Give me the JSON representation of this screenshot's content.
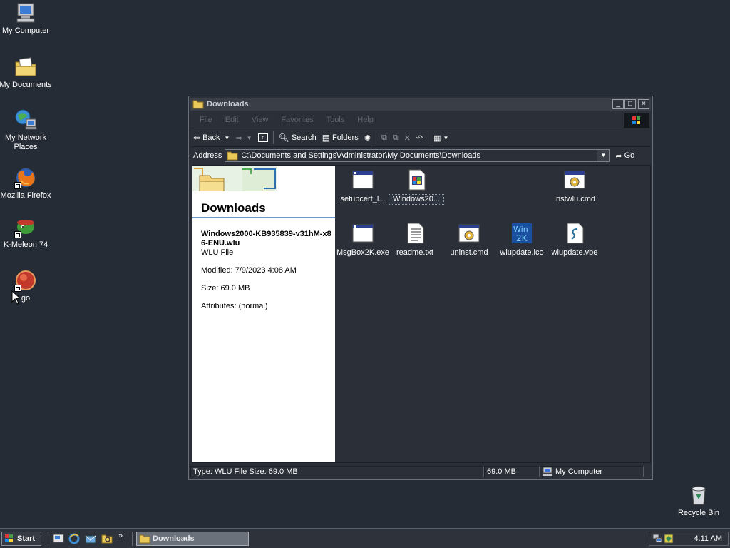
{
  "desktop": {
    "icons": [
      {
        "label": "My Computer",
        "icon": "computer-icon"
      },
      {
        "label": "My Documents",
        "icon": "documents-folder-icon"
      },
      {
        "label": "My Network Places",
        "icon": "network-icon"
      },
      {
        "label": "Mozilla Firefox",
        "icon": "firefox-icon"
      },
      {
        "label": "K-Meleon 74",
        "icon": "k-meleon-icon"
      },
      {
        "label": "go",
        "icon": "go-icon"
      }
    ],
    "recycle_bin": {
      "label": "Recycle Bin",
      "icon": "recycle-bin-icon"
    }
  },
  "window": {
    "title": "Downloads",
    "menu": [
      "File",
      "Edit",
      "View",
      "Favorites",
      "Tools",
      "Help"
    ],
    "toolbar": {
      "back": "Back",
      "search": "Search",
      "folders": "Folders"
    },
    "address": {
      "label": "Address",
      "value": "C:\\Documents and Settings\\Administrator\\My Documents\\Downloads",
      "go": "Go"
    },
    "left_pane": {
      "title": "Downloads",
      "file_name": "Windows2000-KB935839-v31hM-x86-ENU.wlu",
      "file_type": "WLU File",
      "modified": "Modified: 7/9/2023 4:08 AM",
      "size": "Size: 69.0 MB",
      "attributes": "Attributes: (normal)"
    },
    "files": [
      {
        "name": "setupcert_l...",
        "icon": "exe-window-icon"
      },
      {
        "name": "Windows20...",
        "icon": "wlu-file-icon"
      },
      {
        "name": "Instwlu.cmd",
        "icon": "cmd-gear-icon"
      },
      {
        "name": "MsgBox2K.exe",
        "icon": "exe-window-icon"
      },
      {
        "name": "readme.txt",
        "icon": "text-file-icon"
      },
      {
        "name": "uninst.cmd",
        "icon": "cmd-gear-icon"
      },
      {
        "name": "wlupdate.ico",
        "icon": "win2k-ico-icon"
      },
      {
        "name": "wlupdate.vbe",
        "icon": "script-file-icon"
      }
    ],
    "status": {
      "info": "Type: WLU File Size: 69.0 MB",
      "size": "69.0 MB",
      "zone": "My Computer"
    }
  },
  "taskbar": {
    "start": "Start",
    "task": "Downloads",
    "clock": "4:11 AM"
  }
}
